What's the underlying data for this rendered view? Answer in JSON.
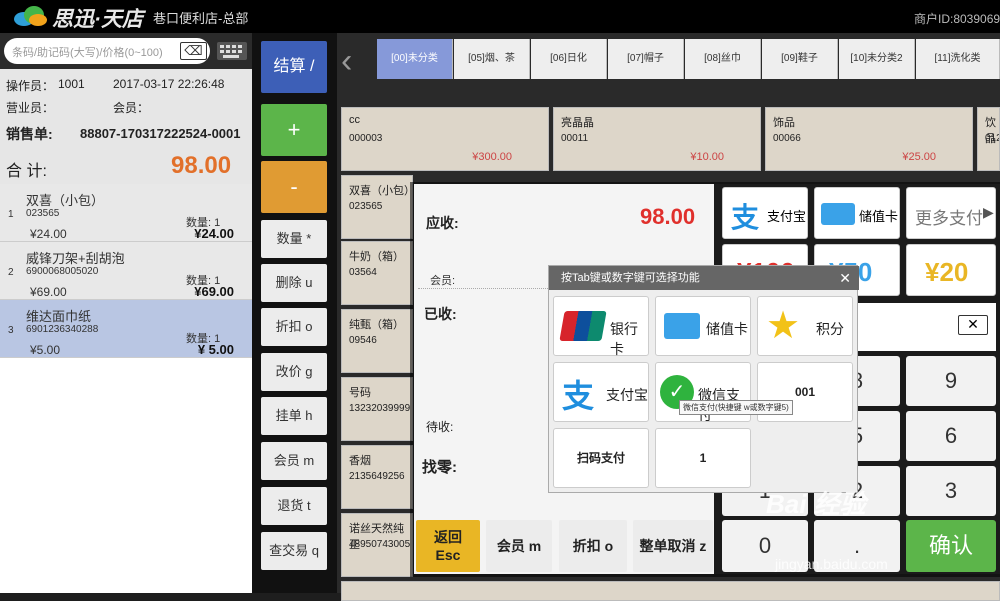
{
  "app": {
    "brand": "思迅·天店",
    "store": "巷口便利店-总部",
    "merchant_id": "商户ID:8039069"
  },
  "search": {
    "placeholder": "条码/助记码(大写)/价格(0~100)"
  },
  "order": {
    "operator_label": "操作员：",
    "operator": "1001",
    "datetime": "2017-03-17 22:26:48",
    "sales_label": "营业员：",
    "member_label": "会员：",
    "order_label": "销售单:",
    "order_no": "88807-170317222524-0001",
    "total_label": "合  计:",
    "total": "98.00"
  },
  "items": [
    {
      "name": "双喜（小包）",
      "idx": "1",
      "code": "023565",
      "qty": "数量:   1",
      "price": "¥24.00",
      "total": "¥24.00"
    },
    {
      "name": "威锋刀架+刮胡泡",
      "idx": "2",
      "code": "6900068005020",
      "qty": "数量:   1",
      "price": "¥69.00",
      "total": "¥69.00"
    },
    {
      "name": "维达面巾纸",
      "idx": "3",
      "code": "6901236340288",
      "qty": "数量:   1",
      "price": "¥5.00",
      "total": "¥ 5.00"
    }
  ],
  "actions": {
    "checkout": "结算 /",
    "plus": "+",
    "minus": "-",
    "qty": "数量 *",
    "delete": "删除 u",
    "discount": "折扣 o",
    "reprice": "改价 g",
    "hold": "挂单 h",
    "member": "会员 m",
    "refund": "退货 t",
    "query": "查交易 q"
  },
  "categories": [
    "[00]未分类",
    "[05]烟、茶",
    "[06]日化",
    "[07]帽子",
    "[08]丝巾",
    "[09]鞋子",
    "[10]未分类2",
    "[11]洗化类"
  ],
  "products": [
    {
      "name": "cc",
      "code": "000003",
      "price": "¥300.00"
    },
    {
      "name": "亮晶晶",
      "code": "00011",
      "price": "¥10.00"
    },
    {
      "name": "饰品",
      "code": "00066",
      "price": "¥25.00"
    },
    {
      "name": "饮品",
      "code": "0123",
      "price": ""
    },
    {
      "name": "双喜（小包）",
      "code": "023565",
      "price": ""
    },
    {
      "name": "牛奶（箱）",
      "code": "03564",
      "price": ""
    },
    {
      "name": "纯甄（箱）",
      "code": "09546",
      "price": ""
    },
    {
      "name": "号码",
      "code": "13232039999",
      "price": ""
    },
    {
      "name": "香烟",
      "code": "2135649256",
      "price": ""
    },
    {
      "name": "诺丝天然纯正",
      "code": "48950743005",
      "price": ""
    }
  ],
  "payment": {
    "due_label": "应收:",
    "due": "98.00",
    "member_label": "会员:",
    "received_label": "已收:",
    "pending_label": "待收:",
    "change_label": "找零:",
    "alipay": "支付宝",
    "stored": "储值卡",
    "more": "更多支付",
    "quick": [
      "¥100",
      "¥50",
      "¥20"
    ],
    "keys": [
      "9",
      "6",
      "3",
      "0"
    ],
    "confirm": "确认",
    "back": "返回",
    "back_key": "Esc",
    "member_btn": "会员 m",
    "discount_btn": "折扣 o",
    "cancel_btn": "整单取消 z"
  },
  "dialog": {
    "title": "按Tab键或数字键可选择功能",
    "bank": "银行卡",
    "stored": "储值卡",
    "points": "积分",
    "alipay": "支付宝",
    "wechat": "微信支付",
    "code001": "001",
    "scan": "扫码支付",
    "one": "1",
    "tooltip": "微信支付(快捷键 w或数字键5)"
  },
  "colors": {
    "accent_blue": "#3d5fb7",
    "total_orange": "#e2702a",
    "green": "#5cb54a",
    "red": "#e0302c"
  }
}
